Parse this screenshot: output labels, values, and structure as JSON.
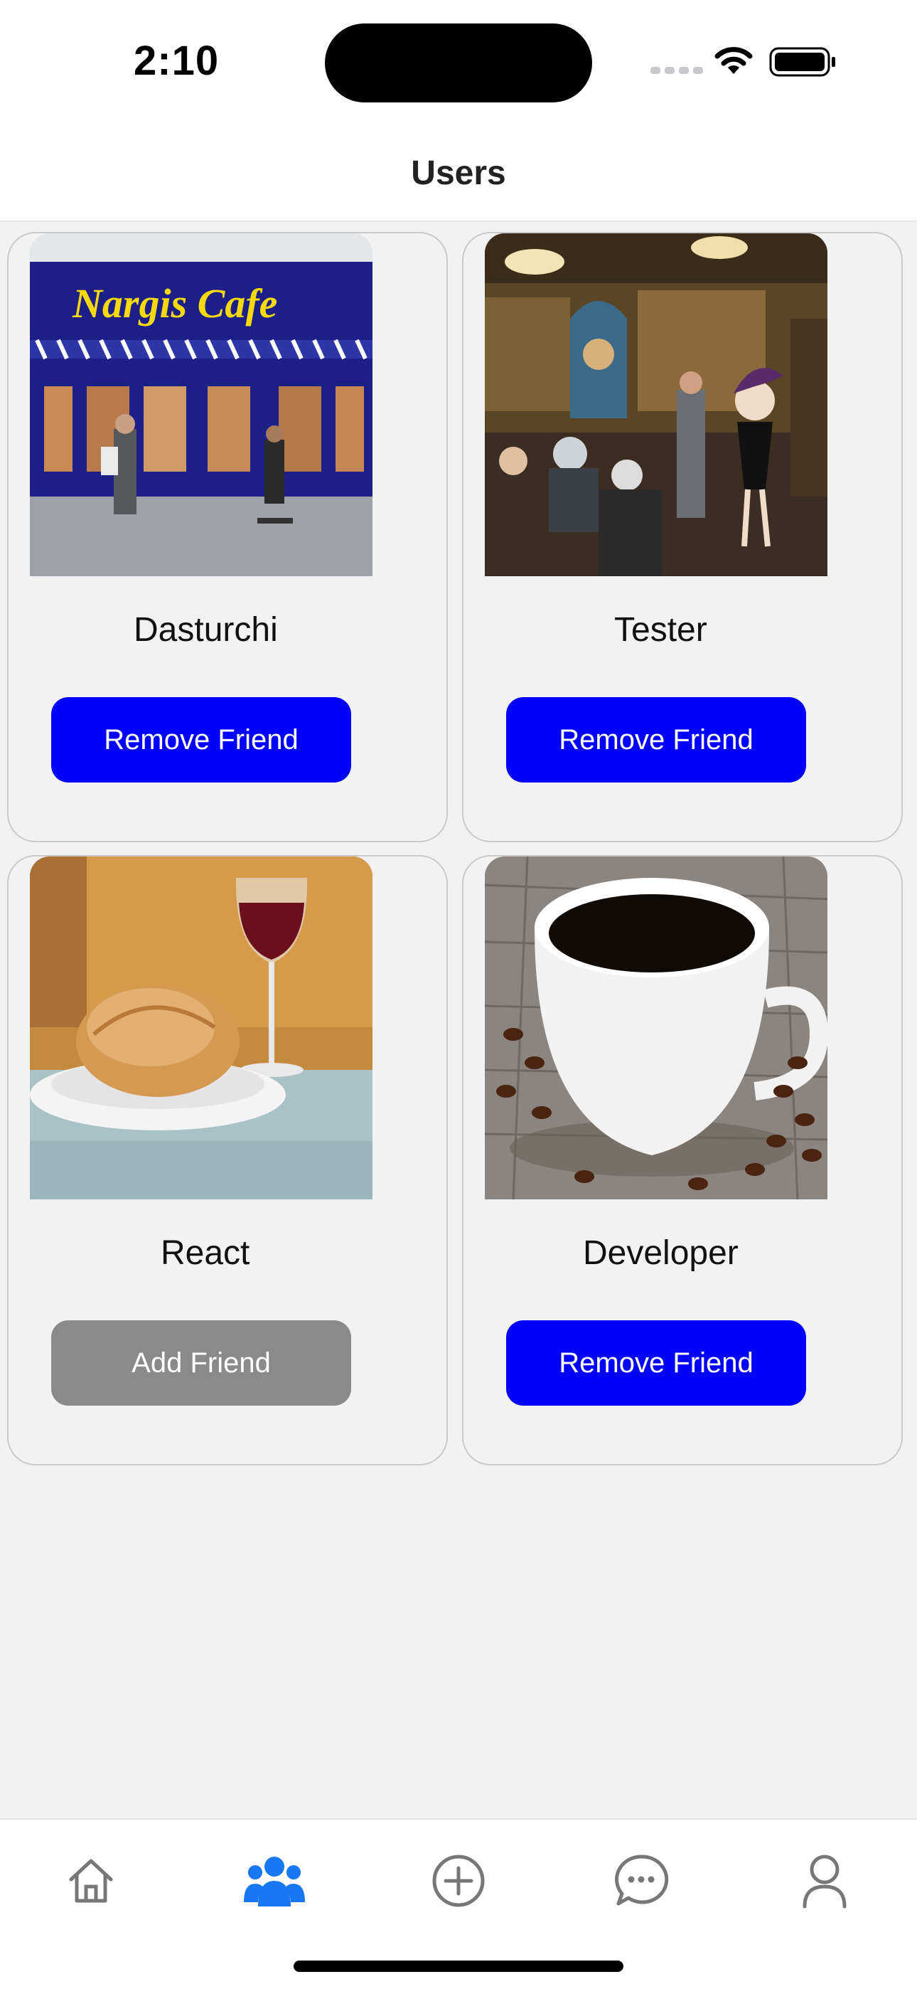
{
  "status_bar": {
    "time": "2:10",
    "icons": [
      "signal-icon",
      "wifi-icon",
      "battery-icon"
    ]
  },
  "header": {
    "title": "Users"
  },
  "users": [
    {
      "name": "Dasturchi",
      "button_label": "Remove Friend",
      "button_state": "remove",
      "photo": "cafe-storefront-photo",
      "sign_text": "Nargis Cafe"
    },
    {
      "name": "Tester",
      "button_label": "Remove Friend",
      "button_state": "remove",
      "photo": "restaurant-interior-photo"
    },
    {
      "name": "React",
      "button_label": "Add Friend",
      "button_state": "add",
      "photo": "pastry-and-wine-photo"
    },
    {
      "name": "Developer",
      "button_label": "Remove Friend",
      "button_state": "remove",
      "photo": "coffee-cup-photo"
    }
  ],
  "tab_bar": {
    "tabs": [
      {
        "icon": "home-icon",
        "active": false
      },
      {
        "icon": "users-icon",
        "active": true
      },
      {
        "icon": "add-circle-icon",
        "active": false
      },
      {
        "icon": "chat-icon",
        "active": false
      },
      {
        "icon": "profile-icon",
        "active": false
      }
    ]
  },
  "colors": {
    "remove_button": "#0000ff",
    "add_button": "#8a8a8a",
    "active_tab": "#1877f2",
    "inactive_tab": "#777777",
    "background": "#f2f2f2"
  }
}
